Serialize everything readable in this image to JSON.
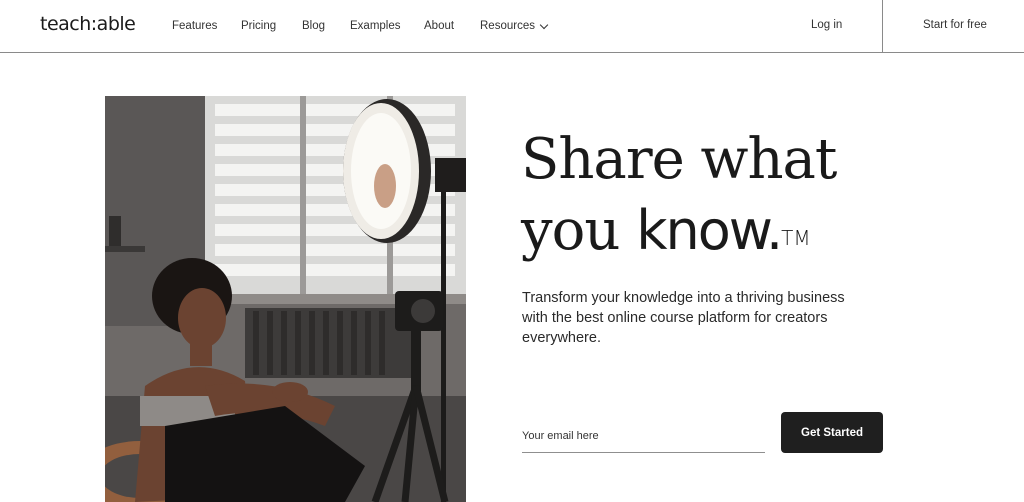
{
  "header": {
    "logo": "teach:able",
    "nav": [
      {
        "label": "Features"
      },
      {
        "label": "Pricing"
      },
      {
        "label": "Blog"
      },
      {
        "label": "Examples"
      },
      {
        "label": "About"
      },
      {
        "label": "Resources"
      }
    ],
    "login_label": "Log in",
    "cta_label": "Start for free"
  },
  "hero": {
    "headline_line1": "Share what",
    "headline_line2_a": "you ",
    "headline_line2_b": "know.",
    "trademark": "TM",
    "subtext": "Transform your knowledge into a thriving business with the best online course platform for creators everywhere.",
    "email_placeholder": "Your email here",
    "button_label": "Get Started"
  },
  "colors": {
    "button_bg": "#1f1f1f",
    "text": "#1a1a1a",
    "divider": "#8a8a8a"
  }
}
